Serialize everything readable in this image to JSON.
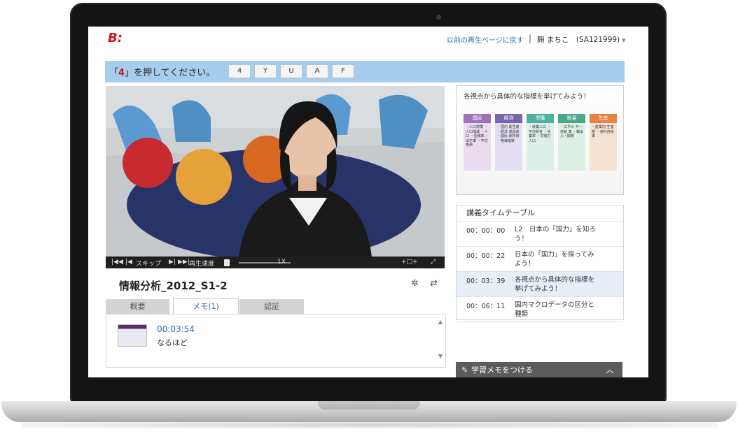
{
  "header": {
    "logo_text": "B:",
    "back_link": "以前の再生ページに戻す",
    "user": "麹 まちこ　(SA121999)"
  },
  "captcha": {
    "prompt_open": "「",
    "prompt_key": "4",
    "prompt_close": "」を押してください。",
    "keys": [
      "4",
      "Y",
      "U",
      "A",
      "F"
    ]
  },
  "player": {
    "skip_label": "スキップ",
    "speed_label": "再生速度",
    "speed_value": "1X",
    "title": "情報分析_2012_S1-2"
  },
  "tabs": [
    {
      "label": "概要"
    },
    {
      "label": "メモ(1)"
    },
    {
      "label": "認証"
    }
  ],
  "memo": {
    "time": "00:03:54",
    "text": "なるほど"
  },
  "slide": {
    "title": "各視点から具体的な指標を挙げてみよう！",
    "categories": [
      {
        "name": "国民",
        "color": "#a070b8",
        "body": "・人口規模 ・人口増減 ・人口 ・団塊率 ・出生率 ・平均寿命"
      },
      {
        "name": "経済",
        "color": "#7865b0",
        "body": "・国内 総生産 ・経済 成長率 ・国民 総所得 ・物価指数"
      },
      {
        "name": "労働",
        "color": "#4db29b",
        "body": "・就業人口 ・平均賃金 ・失業率 ・労働力 人口"
      },
      {
        "name": "貿易",
        "color": "#4aa88c",
        "body": "・エネル ギー自給 率 ・輸出 入・関税"
      },
      {
        "name": "生産",
        "color": "#e8833f",
        "body": "・産業別 生産額 ・食料自給 率"
      }
    ]
  },
  "timetable": {
    "title": "講義タイムテーブル",
    "rows": [
      {
        "time": "00：00：00",
        "desc": "L2　日本の「国力」を知ろう！"
      },
      {
        "time": "00：00：22",
        "desc": "日本の「国力」を探ってみよう！"
      },
      {
        "time": "00：03：39",
        "desc": "各視点から具体的な指標を挙げてみよう！"
      },
      {
        "time": "00：06：11",
        "desc": "国内マクロデータの区分と種類"
      }
    ]
  },
  "memo_bar": {
    "label": "学習メモをつける"
  }
}
